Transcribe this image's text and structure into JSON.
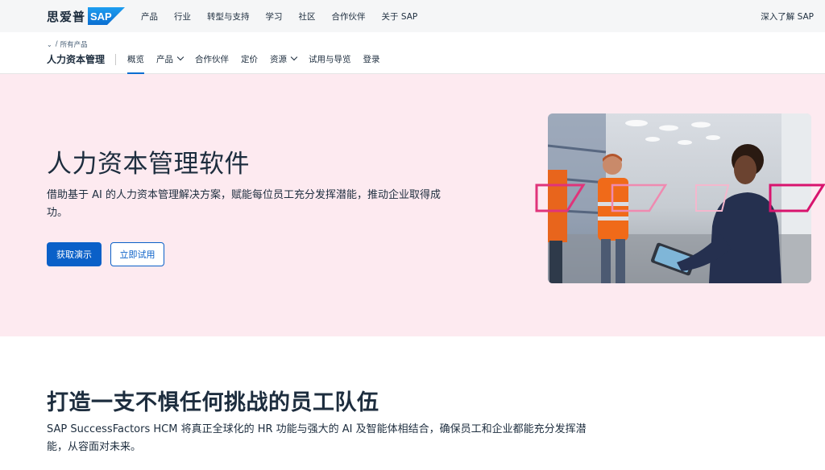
{
  "topbar": {
    "logo_cn": "思爱普",
    "logo_sap": "SAP",
    "nav": [
      "产品",
      "行业",
      "转型与支持",
      "学习",
      "社区",
      "合作伙伴",
      "关于 SAP"
    ],
    "right_link": "深入了解 SAP"
  },
  "subnav": {
    "breadcrumb": "所有产品",
    "product_name": "人力资本管理",
    "items": [
      {
        "label": "概览",
        "active": true
      },
      {
        "label": "产品",
        "dropdown": true
      },
      {
        "label": "合作伙伴"
      },
      {
        "label": "定价"
      },
      {
        "label": "资源",
        "dropdown": true
      },
      {
        "label": "试用与导览"
      },
      {
        "label": "登录"
      }
    ]
  },
  "hero": {
    "title": "人力资本管理软件",
    "description": "借助基于 AI 的人力资本管理解决方案，赋能每位员工充分发挥潜能，推动企业取得成功。",
    "primary_button": "获取演示",
    "secondary_button": "立即试用",
    "background_color": "#fdeaf0",
    "accent_color": "#0a60c8"
  },
  "section": {
    "title": "打造一支不惧任何挑战的员工队伍",
    "description": "SAP SuccessFactors HCM 将真正全球化的 HR 功能与强大的 AI 及智能体相结合，确保员工和企业都能充分发挥潜能，从容面对未来。"
  }
}
